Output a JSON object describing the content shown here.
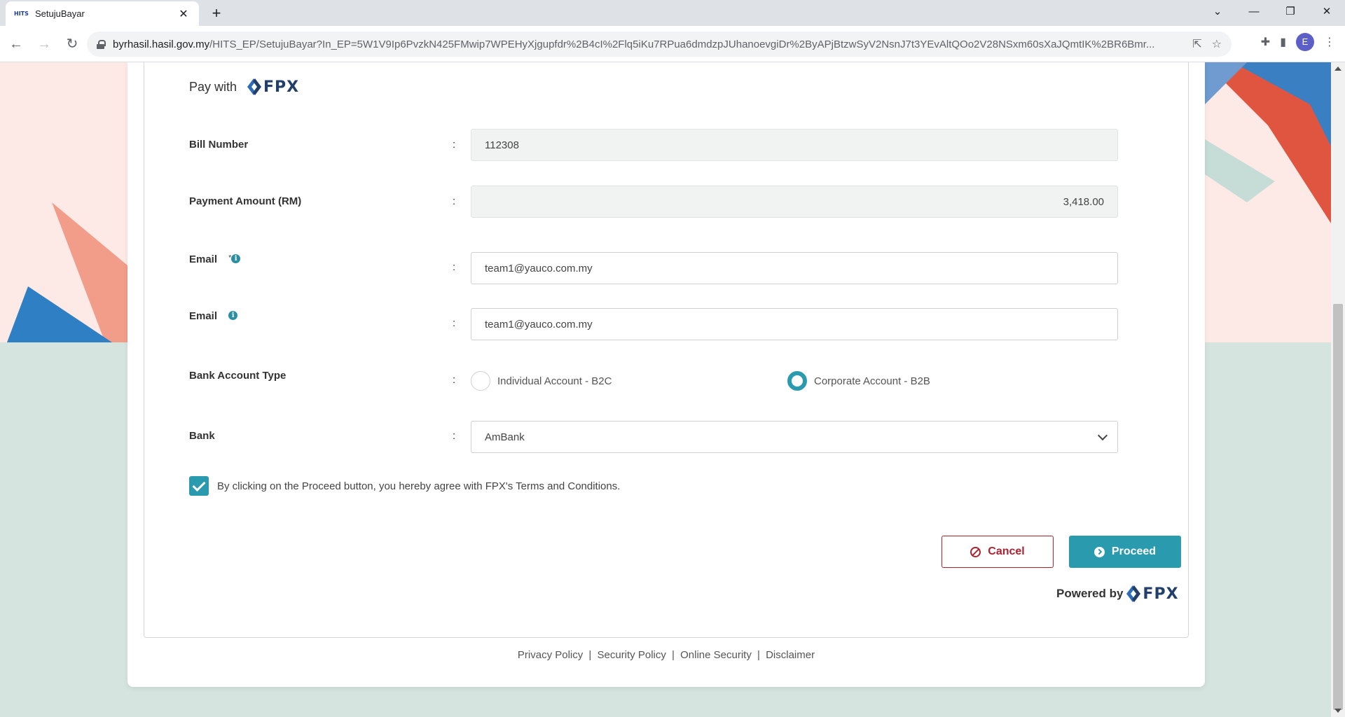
{
  "browser": {
    "tab_title": "SetujuBayar",
    "favicon_text": "HITS",
    "url_host": "byrhasil.hasil.gov.my",
    "url_path": "/HITS_EP/SetujuBayar?In_EP=5W1V9Ip6PvzkN425FMwip7WPEHyXjgupfdr%2B4cI%2Flq5iKu7RPua6dmdzpJUhanoevgiDr%2ByAPjBtzwSyV2NsnJ7t3YEvAltQOo2V28NSxm60sXaJQmtIK%2BR6Bmr...",
    "profile_initial": "E"
  },
  "form": {
    "pay_with_label": "Pay with",
    "fpx_logo_text": "FPX",
    "bill_number": {
      "label": "Bill Number",
      "value": "112308"
    },
    "payment_amount": {
      "label": "Payment Amount (RM)",
      "value": "3,418.00"
    },
    "email": {
      "label": "Email",
      "marker": "*",
      "value": "team1@yauco.com.my"
    },
    "email_confirm": {
      "label": "Email",
      "value": "team1@yauco.com.my"
    },
    "bank_account_type": {
      "label": "Bank Account Type",
      "options": [
        {
          "label": "Individual Account - B2C",
          "selected": false
        },
        {
          "label": "Corporate Account - B2B",
          "selected": true
        }
      ]
    },
    "bank": {
      "label": "Bank",
      "selected": "AmBank"
    },
    "colon": ":",
    "agreement": {
      "text_before": "By clicking on the Proceed button, you hereby agree with ",
      "link": "FPX's Terms and Conditions",
      "text_after": ".",
      "checked": true
    },
    "cancel_label": "Cancel",
    "proceed_label": "Proceed",
    "powered_by_label": "Powered by"
  },
  "footer": {
    "links": [
      "Privacy Policy",
      "Security Policy",
      "Online Security",
      "Disclaimer"
    ],
    "separator": "|"
  },
  "colors": {
    "accent": "#2a9aae",
    "cancel": "#b02130",
    "fpx_navy": "#223e6b",
    "page_bg": "#d5e4df",
    "pink_band": "#fdeae6"
  }
}
